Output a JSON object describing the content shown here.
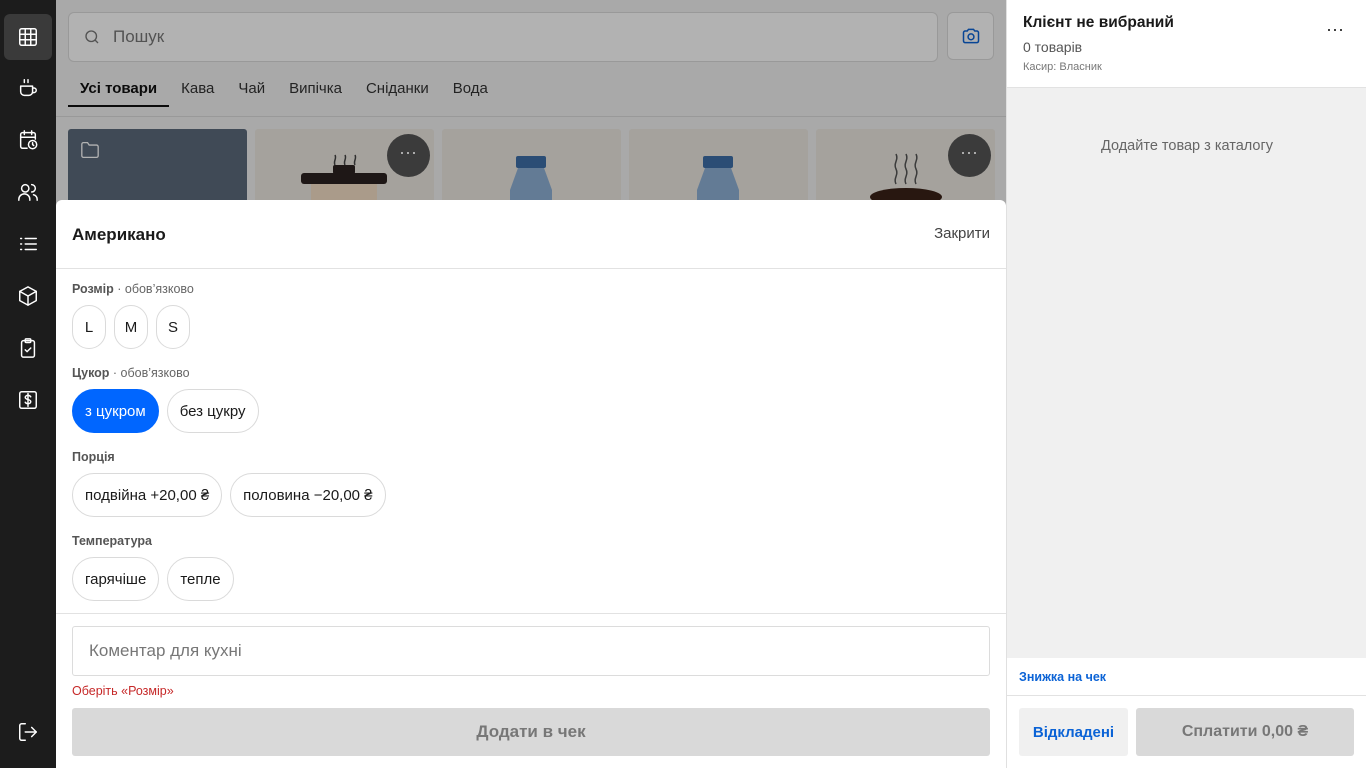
{
  "rail": {
    "items": [
      {
        "icon": "grid-icon",
        "active": true
      },
      {
        "icon": "coffee-cup-icon"
      },
      {
        "icon": "calendar-clock-icon"
      },
      {
        "icon": "users-icon"
      },
      {
        "icon": "list-icon"
      },
      {
        "icon": "box-icon"
      },
      {
        "icon": "clipboard-check-icon"
      },
      {
        "icon": "cash-icon"
      }
    ],
    "logout_icon": "logout-icon"
  },
  "catalog": {
    "search_placeholder": "Пошук",
    "tabs": [
      "Усі товари",
      "Кава",
      "Чай",
      "Випічка",
      "Сніданки",
      "Вода"
    ],
    "active_tab": 0,
    "more_glyph": "⋯"
  },
  "modal": {
    "title": "Американо",
    "close_label": "Закрити",
    "groups": [
      {
        "name": "Розмір",
        "note": " · обов’язково",
        "options": [
          "L",
          "M",
          "S"
        ],
        "selected": null
      },
      {
        "name": "Цукор",
        "note": " · обов’язково",
        "options": [
          "з цукром",
          "без цукру"
        ],
        "selected": 0
      },
      {
        "name": "Порція",
        "note": "",
        "options": [
          "подвійна +20,00 ₴",
          "половина −20,00 ₴"
        ],
        "selected": null
      },
      {
        "name": "Температура",
        "note": "",
        "options": [
          "гарячіше",
          "тепле"
        ],
        "selected": null
      }
    ],
    "comment_placeholder": "Коментар для кухні",
    "error": "Оберіть «Розмір»",
    "add_label": "Додати в чек"
  },
  "cart": {
    "client": "Клієнт не вибраний",
    "items_count": "0 товарів",
    "cashier": "Касир: Власник",
    "menu_glyph": "⋯",
    "empty_hint": "Додайте товар з каталогу",
    "discount_label": "Знижка на чек",
    "deferred_label": "Відкладені",
    "pay_label": "Сплатити 0,00 ₴"
  },
  "colors": {
    "accent": "#0066ff",
    "link": "#0b63d6",
    "error": "#c62828",
    "rail": "#1c1c1c"
  }
}
